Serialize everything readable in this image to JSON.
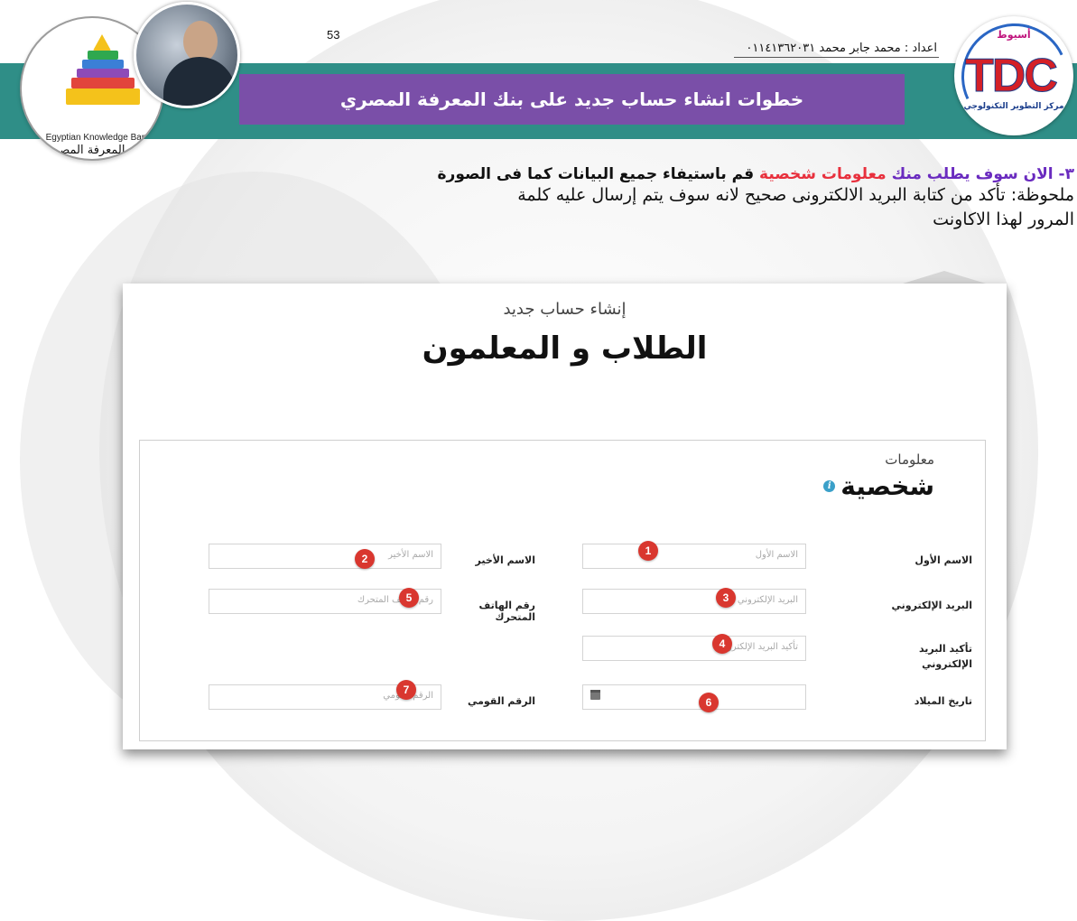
{
  "header": {
    "page_number": "53",
    "author": "اعداد : محمد جابر محمد ٠١١٤١٣٦٢٠٣١",
    "title": "خطوات انشاء حساب جديد على بنك المعرفة المصري"
  },
  "logos": {
    "ekb_en": "Egyptian Knowledge Bank",
    "ekb_ar": "بنك المعرفة المصري",
    "tdc_letters": "TDC",
    "tdc_top": "أسيوط",
    "tdc_bottom": "مركز التطوير التكنولوجي"
  },
  "instructions": {
    "step_number": "٣-",
    "step_part1": "الان سوف يطلب منك",
    "step_part2": "معلومات شخصية",
    "step_part3": "قم باستيفاء جميع البيانات كما فى الصورة",
    "note_line1": "ملحوظة: تأكد من كتابة البريد الالكترونى صحيح لانه سوف يتم إرسال عليه كلمة",
    "note_line2": "المرور لهذا الاكاونت"
  },
  "form": {
    "subtitle": "إنشاء حساب جديد",
    "title": "الطلاب و المعلمون",
    "section_small": "معلومات",
    "section_big": "شخصية",
    "info_icon": "i",
    "fields": {
      "first_name": {
        "label": "الاسم الأول",
        "placeholder": "الاسم الأول",
        "badge": "1"
      },
      "last_name": {
        "label": "الاسم الأخير",
        "placeholder": "الاسم الأخير",
        "badge": "2"
      },
      "email": {
        "label": "البريد الإلكتروني",
        "placeholder": "البريد الإلكتروني",
        "badge": "3"
      },
      "confirm_email": {
        "label": "تأكيد البريد الإلكتروني",
        "placeholder": "تأكيد البريد الإلكتروني",
        "badge": "4"
      },
      "mobile": {
        "label": "رقم الهاتف المتحرك",
        "placeholder": "رقم الهاتف المتحرك",
        "badge": "5"
      },
      "birth_date": {
        "label": "تاريخ الميلاد",
        "placeholder": "",
        "badge": "6",
        "icon": "calendar-icon"
      },
      "national_id": {
        "label": "الرقم القومي",
        "placeholder": "الرقم القومي",
        "badge": "7"
      }
    }
  },
  "colors": {
    "band": "#2f8e87",
    "title_box": "#7a4fa8",
    "step_purple": "#6a2bbf",
    "step_red": "#e8303d",
    "badge": "#d9372f"
  }
}
